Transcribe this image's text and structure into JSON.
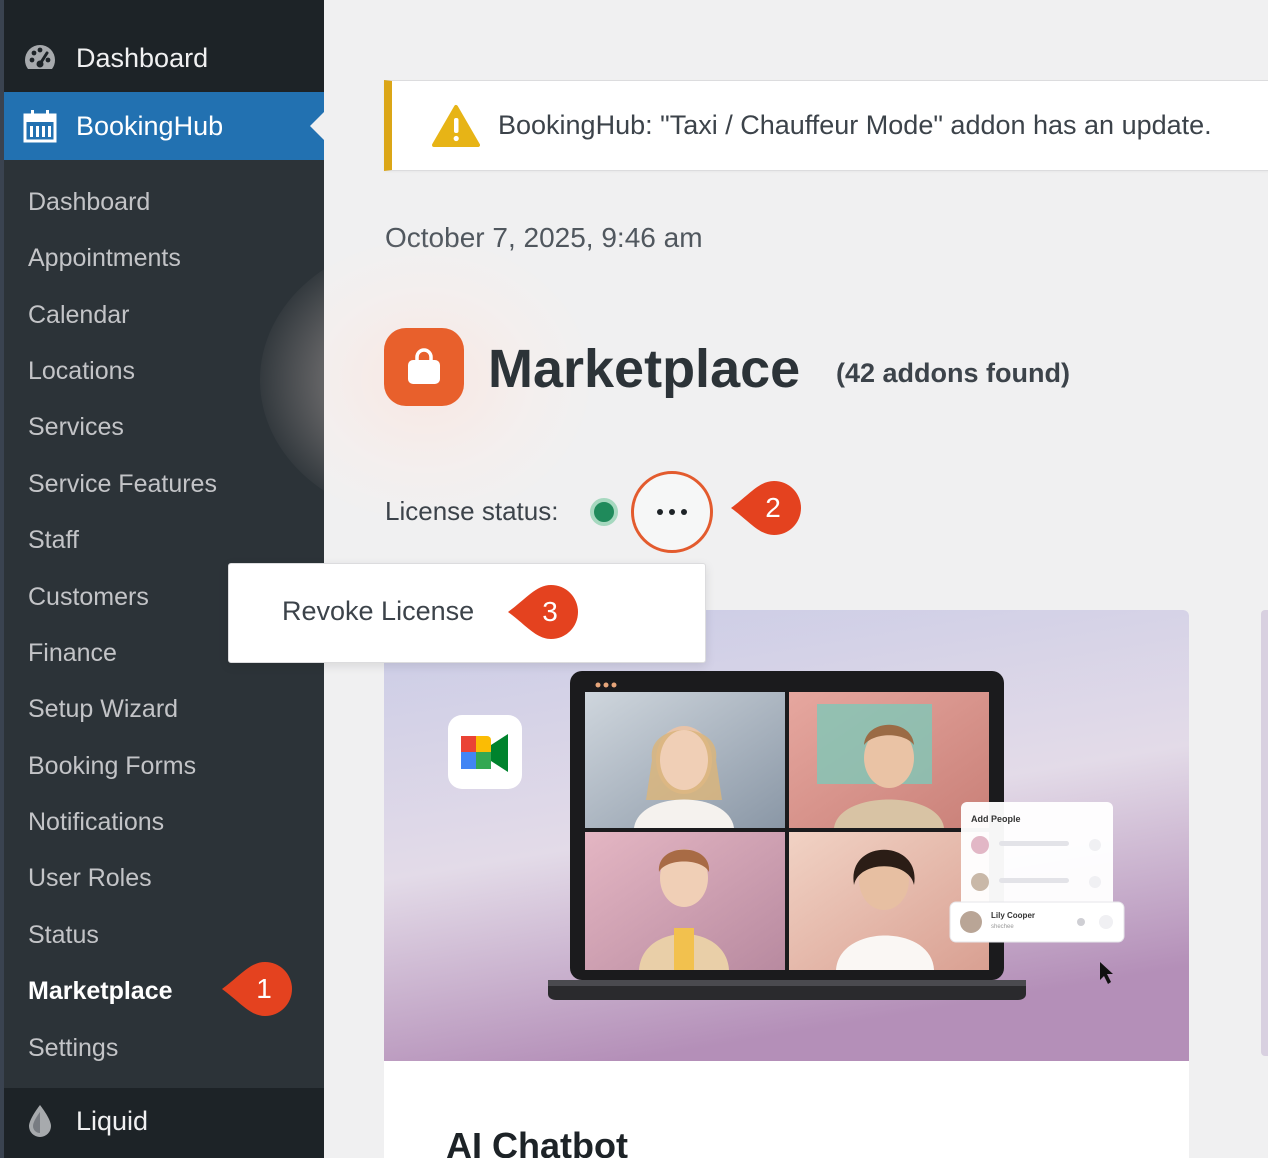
{
  "sidebar": {
    "dashboard": "Dashboard",
    "bookinghub": "BookingHub",
    "submenu": [
      "Dashboard",
      "Appointments",
      "Calendar",
      "Locations",
      "Services",
      "Service Features",
      "Staff",
      "Customers",
      "Finance",
      "Setup Wizard",
      "Booking Forms",
      "Notifications",
      "User Roles",
      "Status",
      "Marketplace",
      "Settings"
    ],
    "current_item": "Marketplace",
    "bottom_item": "Liquid"
  },
  "notice": {
    "text": "BookingHub: \"Taxi / Chauffeur Mode\" addon has an update."
  },
  "datetime": "October 7, 2025, 9:46 am",
  "marketplace": {
    "title": "Marketplace",
    "count": "(42 addons found)"
  },
  "license": {
    "label": "License status:",
    "menu_item": "Revoke License"
  },
  "callouts": [
    "1",
    "2",
    "3"
  ],
  "card": {
    "title": "AI Chatbot",
    "panel_title": "Add People",
    "person_name": "Lily Cooper",
    "person_sub": "shechee"
  },
  "colors": {
    "sidebar_bg": "#1d2327",
    "submenu_bg": "#2c3338",
    "active_blue": "#2271b1",
    "accent_orange": "#e8602c",
    "callout_red": "#e4421f",
    "warning_yellow": "#dba617",
    "status_green": "#1f8a5b"
  }
}
